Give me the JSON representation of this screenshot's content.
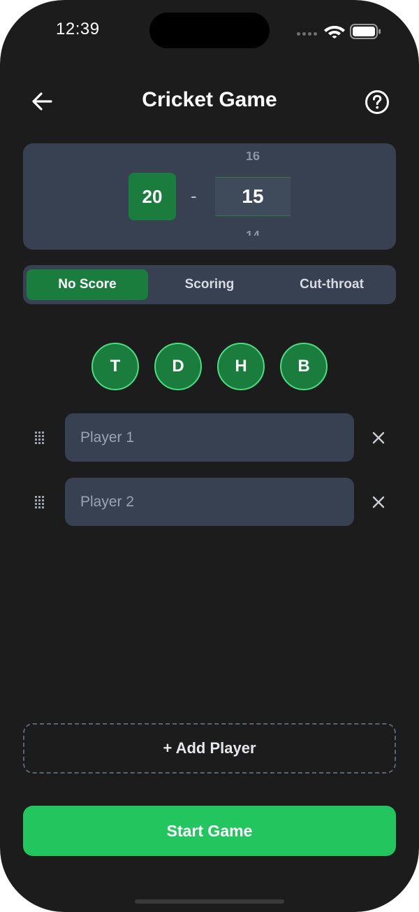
{
  "status_bar": {
    "time": "12:39"
  },
  "header": {
    "title": "Cricket Game",
    "back_icon": "arrow-left-icon",
    "help_icon": "question-circle-icon"
  },
  "target_picker": {
    "start_value": "20",
    "separator": "-",
    "wheel_above": "16",
    "wheel_selected": "15",
    "wheel_below": "14"
  },
  "mode_tabs": [
    {
      "label": "No Score",
      "active": true
    },
    {
      "label": "Scoring",
      "active": false
    },
    {
      "label": "Cut-throat",
      "active": false
    }
  ],
  "multipliers": [
    "T",
    "D",
    "H",
    "B"
  ],
  "players": [
    {
      "placeholder": "Player 1",
      "value": ""
    },
    {
      "placeholder": "Player 2",
      "value": ""
    }
  ],
  "actions": {
    "add_player": "+ Add Player",
    "start_game": "Start Game"
  },
  "colors": {
    "background": "#1c1c1c",
    "surface": "#374151",
    "accent": "#1a7d3e",
    "accent_border": "#4ade80",
    "primary_button": "#22c55e"
  }
}
